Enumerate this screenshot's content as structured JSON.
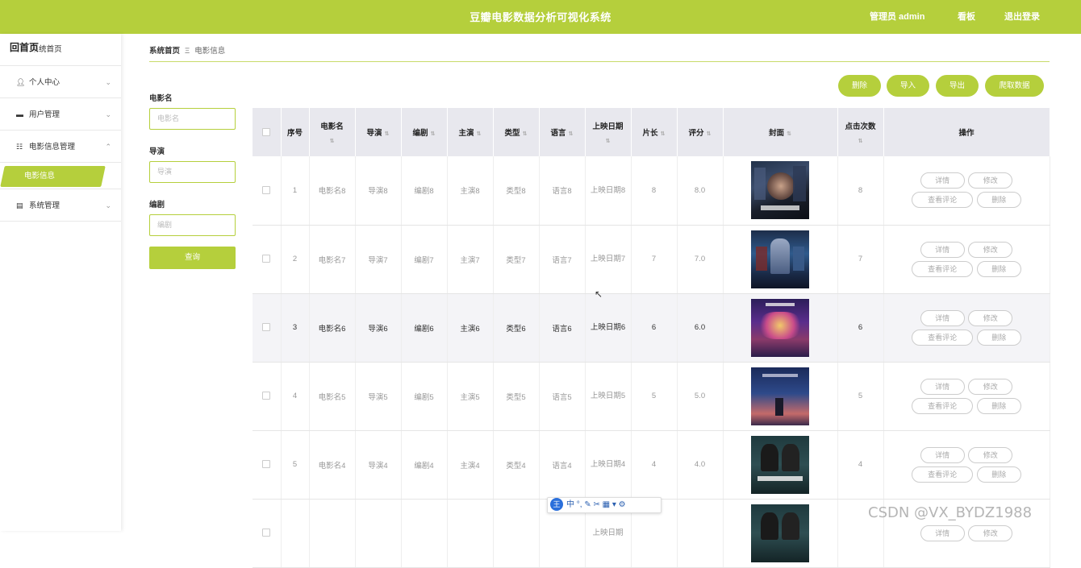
{
  "header": {
    "title": "豆瓣电影数据分析可视化系统",
    "admin": "管理员 admin",
    "dashboard": "看板",
    "logout": "退出登录"
  },
  "sidebar": {
    "logo": "回首页",
    "items": [
      {
        "label": "系统首页",
        "icon": "home-icon"
      },
      {
        "label": "个人中心",
        "icon": "user-icon"
      },
      {
        "label": "用户管理",
        "icon": "monitor-icon"
      },
      {
        "label": "电影信息管理",
        "icon": "grid-icon"
      },
      {
        "label": "电影信息",
        "icon": ""
      },
      {
        "label": "系统管理",
        "icon": "clipboard-icon"
      }
    ]
  },
  "breadcrumb": {
    "home": "系统首页",
    "sep": "Ξ",
    "current": "电影信息"
  },
  "filters": {
    "f1_label": "电影名",
    "f1_placeholder": "电影名",
    "f2_label": "导演",
    "f2_placeholder": "导演",
    "f3_label": "编剧",
    "f3_placeholder": "编剧",
    "query": "查询"
  },
  "actions": {
    "delete": "删除",
    "import": "导入",
    "export": "导出",
    "crawl": "爬取数据"
  },
  "table": {
    "headers": [
      "序号",
      "电影名",
      "导演",
      "编剧",
      "主演",
      "类型",
      "语言",
      "上映日期",
      "片长",
      "评分",
      "封面",
      "点击次数",
      "操作"
    ],
    "row_buttons": {
      "detail": "详情",
      "edit": "修改",
      "comments": "查看评论",
      "delete": "删除"
    },
    "rows": [
      {
        "no": "1",
        "name": "电影名8",
        "director": "导演8",
        "writer": "编剧8",
        "actor": "主演8",
        "genre": "类型8",
        "lang": "语言8",
        "date": "上映日期8",
        "length": "8",
        "score": "8.0",
        "clicks": "8"
      },
      {
        "no": "2",
        "name": "电影名7",
        "director": "导演7",
        "writer": "编剧7",
        "actor": "主演7",
        "genre": "类型7",
        "lang": "语言7",
        "date": "上映日期7",
        "length": "7",
        "score": "7.0",
        "clicks": "7"
      },
      {
        "no": "3",
        "name": "电影名6",
        "director": "导演6",
        "writer": "编剧6",
        "actor": "主演6",
        "genre": "类型6",
        "lang": "语言6",
        "date": "上映日期6",
        "length": "6",
        "score": "6.0",
        "clicks": "6"
      },
      {
        "no": "4",
        "name": "电影名5",
        "director": "导演5",
        "writer": "编剧5",
        "actor": "主演5",
        "genre": "类型5",
        "lang": "语言5",
        "date": "上映日期5",
        "length": "5",
        "score": "5.0",
        "clicks": "5"
      },
      {
        "no": "5",
        "name": "电影名4",
        "director": "导演4",
        "writer": "编剧4",
        "actor": "主演4",
        "genre": "类型4",
        "lang": "语言4",
        "date": "上映日期4",
        "length": "4",
        "score": "4.0",
        "clicks": "4"
      },
      {
        "no": "",
        "name": "",
        "director": "",
        "writer": "",
        "actor": "",
        "genre": "",
        "lang": "",
        "date": "上映日期",
        "length": "",
        "score": "",
        "clicks": ""
      }
    ]
  },
  "ime": {
    "text": "中 °, ✎ ✂ ▦ ▾ ⚙",
    "logo": "王"
  },
  "watermark": "CSDN @VX_BYDZ1988",
  "colors": {
    "accent": "#b5cf3c",
    "header_bg": "#e8e8ee"
  }
}
